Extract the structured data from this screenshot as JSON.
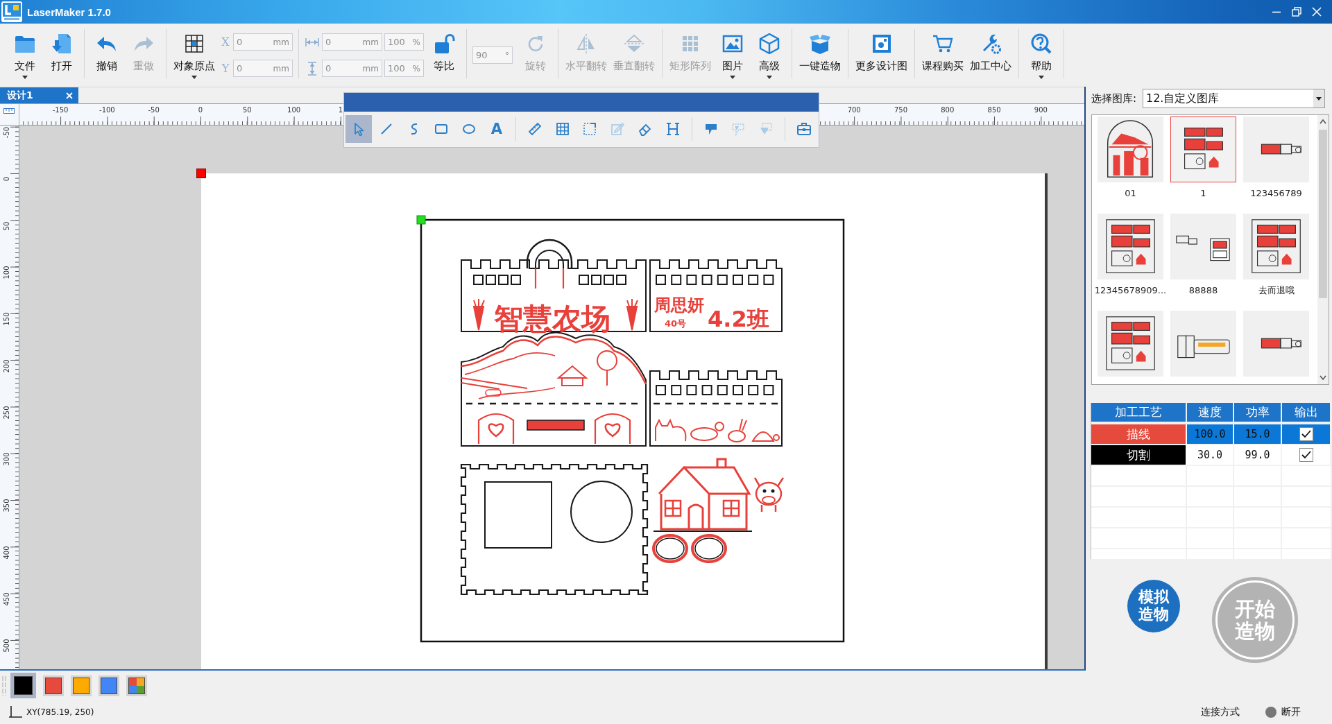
{
  "window": {
    "title": "LaserMaker 1.7.0"
  },
  "toolbar": {
    "groups": [
      [
        {
          "kind": "button",
          "label": "文件",
          "dropdown": true,
          "disabled": false
        },
        {
          "kind": "button",
          "label": "打开",
          "dropdown": false,
          "disabled": false
        }
      ],
      [
        {
          "kind": "button",
          "label": "撤销",
          "dropdown": false,
          "disabled": false
        },
        {
          "kind": "button",
          "label": "重做",
          "dropdown": false,
          "disabled": true
        }
      ],
      [
        {
          "kind": "button",
          "label": "对象原点",
          "dropdown": true,
          "disabled": false
        },
        {
          "kind": "position",
          "fields": [
            {
              "axis": "X",
              "value": "0",
              "unit": "mm",
              "disabled": true
            },
            {
              "axis": "Y",
              "value": "0",
              "unit": "mm",
              "disabled": true
            }
          ]
        }
      ],
      [
        {
          "kind": "size",
          "fields": [
            {
              "value": "0",
              "unit": "mm",
              "scale": "100",
              "scale_unit": "%",
              "disabled": true
            },
            {
              "value": "0",
              "unit": "mm",
              "scale": "100",
              "scale_unit": "%",
              "disabled": true
            }
          ]
        },
        {
          "kind": "button",
          "label": "等比",
          "dropdown": false,
          "disabled": false
        }
      ],
      [
        {
          "kind": "angle",
          "value": "90",
          "unit": "°",
          "disabled": true
        },
        {
          "kind": "button",
          "label": "旋转",
          "dropdown": false,
          "disabled": true
        }
      ],
      [
        {
          "kind": "button",
          "label": "水平翻转",
          "dropdown": false,
          "disabled": true
        },
        {
          "kind": "button",
          "label": "垂直翻转",
          "dropdown": false,
          "disabled": true
        }
      ],
      [
        {
          "kind": "button",
          "label": "矩形阵列",
          "dropdown": false,
          "disabled": true
        },
        {
          "kind": "button",
          "label": "图片",
          "dropdown": true,
          "disabled": false
        },
        {
          "kind": "button",
          "label": "高级",
          "dropdown": true,
          "disabled": false
        }
      ],
      [
        {
          "kind": "button",
          "label": "一键造物",
          "dropdown": false,
          "disabled": false
        }
      ],
      [
        {
          "kind": "button",
          "label": "更多设计图",
          "dropdown": false,
          "disabled": false
        }
      ],
      [
        {
          "kind": "button",
          "label": "课程购买",
          "dropdown": false,
          "disabled": false
        },
        {
          "kind": "button",
          "label": "加工中心",
          "dropdown": false,
          "disabled": false
        }
      ],
      [
        {
          "kind": "button",
          "label": "帮助",
          "dropdown": true,
          "disabled": false
        }
      ]
    ]
  },
  "tabs": [
    {
      "label": "设计1",
      "selected": true
    }
  ],
  "rulers": {
    "horizontal": {
      "left_labels": [
        "-150",
        "-100",
        "-50",
        "0",
        "50",
        "100",
        "1"
      ],
      "right_labels": [
        "700",
        "750",
        "800",
        "850",
        "900"
      ]
    },
    "vertical": {
      "labels": [
        "-50",
        "0",
        "50",
        "100",
        "150",
        "200",
        "250",
        "300",
        "350",
        "400",
        "450",
        "500"
      ]
    }
  },
  "drawing_toolbar": {
    "groups": [
      [
        {
          "kind": "icon",
          "selected": true,
          "disabled": false
        },
        {
          "kind": "icon",
          "selected": false,
          "disabled": false
        },
        {
          "kind": "icon",
          "selected": false,
          "disabled": false
        },
        {
          "kind": "icon",
          "selected": false,
          "disabled": false
        },
        {
          "kind": "icon",
          "selected": false,
          "disabled": false
        },
        {
          "kind": "glyph",
          "glyph": "A",
          "selected": false,
          "disabled": false
        }
      ],
      [
        {
          "kind": "icon",
          "selected": false,
          "disabled": false
        },
        {
          "kind": "icon",
          "selected": false,
          "disabled": false
        },
        {
          "kind": "icon",
          "selected": false,
          "disabled": false
        },
        {
          "kind": "icon",
          "selected": false,
          "disabled": true
        },
        {
          "kind": "icon",
          "selected": false,
          "disabled": false
        },
        {
          "kind": "icon",
          "selected": false,
          "disabled": false
        }
      ],
      [
        {
          "kind": "icon",
          "selected": false,
          "disabled": false
        },
        {
          "kind": "icon",
          "selected": false,
          "disabled": true
        },
        {
          "kind": "icon",
          "selected": false,
          "disabled": true
        }
      ],
      [
        {
          "kind": "icon",
          "selected": false,
          "disabled": false
        }
      ]
    ]
  },
  "design": {
    "title": "智慧农场",
    "name": "周思妍",
    "number": "40号",
    "class_name": "4.2班"
  },
  "library": {
    "label": "选择图库:",
    "value": "12.自定义图库",
    "items": [
      {
        "label": "01",
        "selected": false
      },
      {
        "label": "1",
        "selected": true
      },
      {
        "label": "123456789",
        "selected": false
      },
      {
        "label": "12345678909...",
        "selected": false
      },
      {
        "label": "88888",
        "selected": false
      },
      {
        "label": "去而退哦",
        "selected": false
      },
      {
        "selected": false
      },
      {
        "selected": false
      },
      {
        "selected": false
      }
    ]
  },
  "process_table": {
    "columns": [
      "加工工艺",
      "速度",
      "功率",
      "输出"
    ],
    "rows": [
      {
        "name": "描线",
        "color": "#e64a3c",
        "speed": "100.0",
        "power": "15.0",
        "output": true,
        "selected": true
      },
      {
        "name": "切割",
        "color": "#000000",
        "speed": "30.0",
        "power": "99.0",
        "output": true,
        "selected": false
      }
    ]
  },
  "actions": [
    {
      "kind": "simulate",
      "label": "模拟造物",
      "disabled": false
    },
    {
      "kind": "start",
      "label": "开始造物",
      "disabled": true
    }
  ],
  "palette": [
    {
      "kind": "solid",
      "color": "#000000",
      "selected": true
    },
    {
      "kind": "solid",
      "color": "#e64a3c",
      "selected": false
    },
    {
      "kind": "solid",
      "color": "#ffaa00",
      "selected": false
    },
    {
      "kind": "solid",
      "color": "#4285f4",
      "selected": false
    },
    {
      "kind": "multi",
      "selected": false
    }
  ],
  "status_bar": {
    "coordinates": "XY(785.19, 250)",
    "connection_label": "连接方式",
    "connection_state": "断开",
    "connected": false
  }
}
